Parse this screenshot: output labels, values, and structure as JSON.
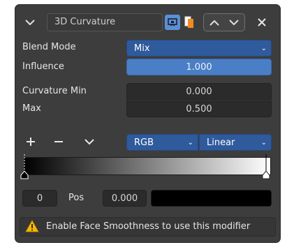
{
  "header": {
    "modifier_name": "3D Curvature"
  },
  "rows": {
    "blend_mode_label": "Blend Mode",
    "blend_mode_value": "Mix",
    "influence_label": "Influence",
    "influence_value": "1.000",
    "curvature_min_label": "Curvature Min",
    "curvature_min_value": "0.000",
    "max_label": "Max",
    "max_value": "0.500"
  },
  "color_ramp": {
    "color_mode": "RGB",
    "interpolation": "Linear",
    "index_value": "0",
    "pos_label": "Pos",
    "pos_value": "0.000",
    "color_swatch": "#000000",
    "gradient_start": "#000000",
    "gradient_end": "#ffffff"
  },
  "warning": {
    "text": "Enable Face Smoothness to use this modifier"
  },
  "colors": {
    "accent_blue": "#4a7fc7",
    "dropdown_blue": "#2f5a9c",
    "warning_yellow": "#f5b800",
    "camera_icon_bg": "#5b8fd6",
    "copy_icon_orange": "#f08a24"
  }
}
